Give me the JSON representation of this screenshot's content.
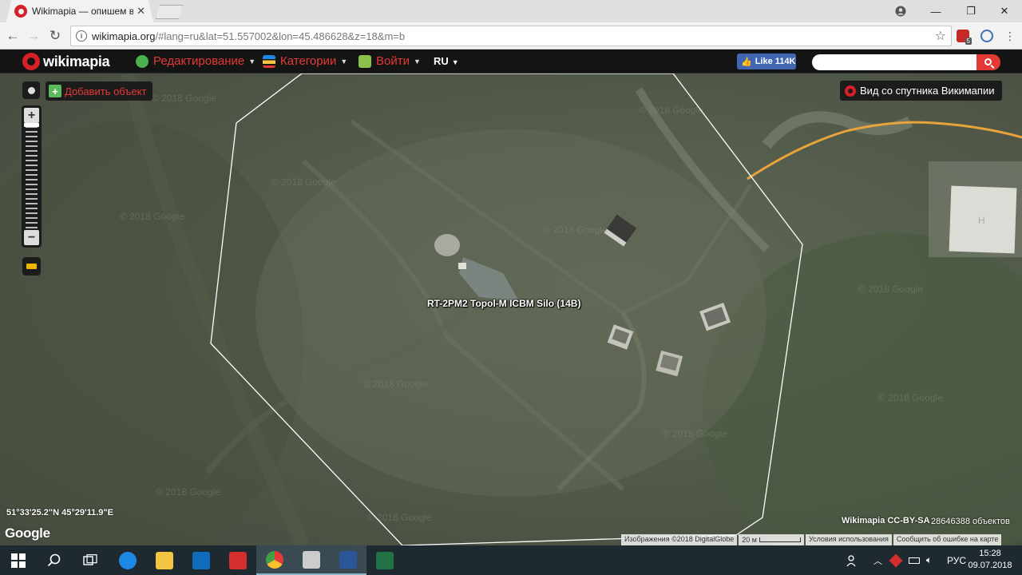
{
  "browser": {
    "tab_title": "Wikimapia — опишем ве",
    "tab_close": "✕",
    "url_host": "wikimapia.org",
    "url_rest": "/#lang=ru&lat=51.557002&lon=45.486628&z=18&m=b",
    "window_minimize": "—",
    "window_maximize": "❐",
    "window_close": "✕",
    "back": "←",
    "forward": "→",
    "reload": "↻",
    "star": "☆",
    "extension_badge": "5"
  },
  "header": {
    "logo_text": "wikimapia",
    "menu": [
      {
        "label": "Редактирование",
        "icon": "globe-edit-icon",
        "color": "#4caf50"
      },
      {
        "label": "Категории",
        "icon": "categories-icon",
        "color": "#1e88e5"
      },
      {
        "label": "Войти",
        "icon": "login-icon",
        "color": "#8bc34a"
      }
    ],
    "language": "RU",
    "fb_like": "Like 114K",
    "fb_thumb": "👍",
    "search_placeholder": ""
  },
  "map": {
    "add_object": "Добавить объект",
    "add_plus": "+",
    "zoom_in": "+",
    "zoom_out": "−",
    "satellite_view": "Вид со спутника Викимапии",
    "object_label": "RT-2PM2 Topol-M ICBM Silo (14B)",
    "coordinates": "51°33'25.2\"N 45°29'11.9\"E",
    "google_logo": "Google",
    "license": "Wikimapia CC-BY-SA",
    "object_count": "28646388 объектов",
    "attribution": {
      "imagery": "Изображения ©2018 DigitalGlobe",
      "scale": "20 м",
      "terms": "Условия использования",
      "report": "Сообщить об ошибке на карте"
    },
    "watermark": "© 2018 Google",
    "road_color": "#e8a33c",
    "polygon_color": "#ffffff"
  },
  "taskbar": {
    "apps": [
      {
        "name": "search-icon",
        "color": "#ffffff"
      },
      {
        "name": "task-view-icon",
        "color": "#ffffff"
      },
      {
        "name": "edge-icon",
        "color": "#1e88e5"
      },
      {
        "name": "file-explorer-icon",
        "color": "#f4c542"
      },
      {
        "name": "outlook-icon",
        "color": "#0f6cbd"
      },
      {
        "name": "acrobat-icon",
        "color": "#d32f2f"
      },
      {
        "name": "chrome-icon",
        "color": "#4caf50"
      },
      {
        "name": "photos-icon",
        "color": "#cccccc"
      },
      {
        "name": "word-icon",
        "color": "#2b579a"
      },
      {
        "name": "excel-icon",
        "color": "#217346"
      }
    ],
    "tray_lang": "РУС",
    "time": "15:28",
    "date": "09.07.2018"
  }
}
